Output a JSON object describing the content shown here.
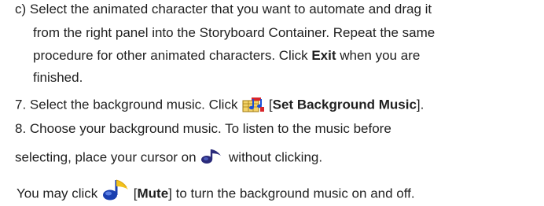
{
  "step_c": {
    "line1": "c)  Select the animated character that you want to automate and drag it",
    "line2": "from the right panel into the Storyboard Container.  Repeat the same",
    "line3_pre": "procedure for other animated characters.  Click ",
    "line3_bold": "Exit",
    "line3_post": " when you are",
    "line4": "finished."
  },
  "step_7": {
    "pre": "7.  Select the background music.  Click ",
    "bracket_open": " [",
    "bold": "Set Background Music",
    "bracket_close": "]."
  },
  "step_8": {
    "line1": "8.  Choose your background music.  To listen to the music before",
    "line2_pre": "selecting, place your cursor on ",
    "line2_post": " without clicking."
  },
  "mute_note": {
    "pre": "You may click ",
    "bracket_open": " [",
    "bold": "Mute",
    "post": "] to turn the background music on and off."
  },
  "icons": {
    "background_music": "music-notes-icon",
    "preview_note": "music-note-icon",
    "mute": "music-note-mute-icon"
  },
  "colors": {
    "text": "#1f1f1f",
    "note_blue": "#1a4fd6",
    "note_dark": "#2a2a7a",
    "icon_red": "#d8262b",
    "icon_yellow": "#f2c21b"
  }
}
